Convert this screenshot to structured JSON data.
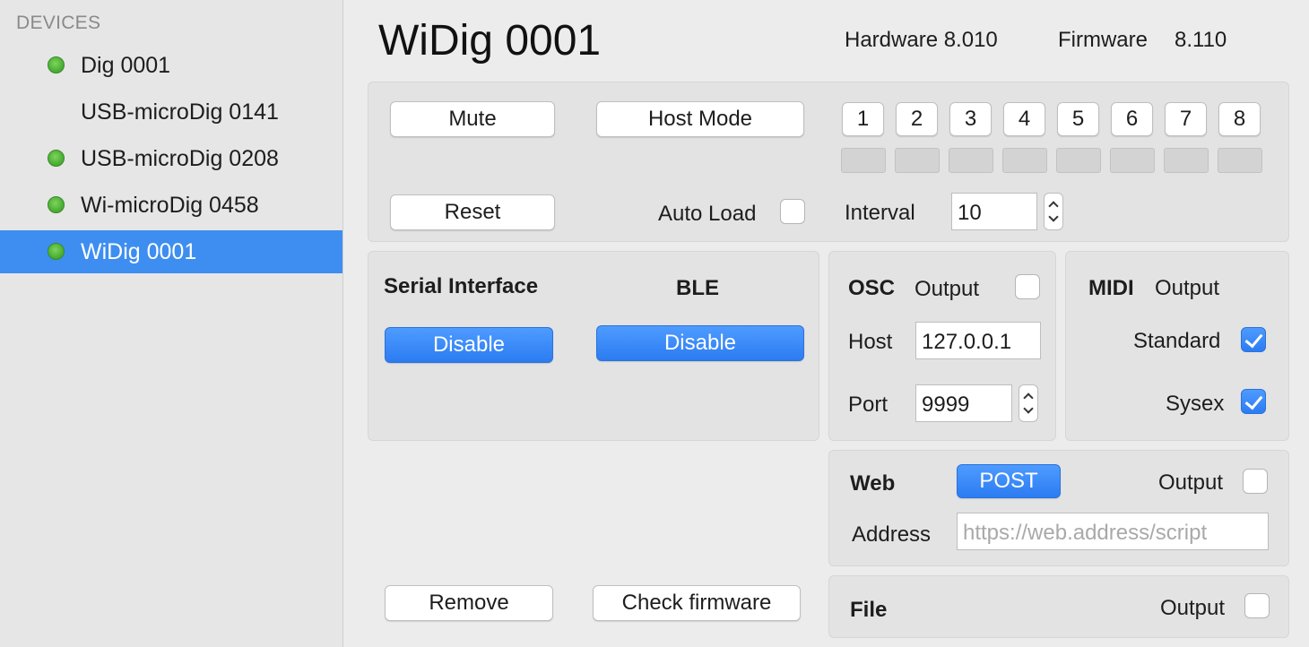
{
  "sidebar": {
    "header": "DEVICES",
    "items": [
      {
        "label": "Dig 0001",
        "status": "online"
      },
      {
        "label": "USB-microDig 0141",
        "status": "none"
      },
      {
        "label": "USB-microDig 0208",
        "status": "online"
      },
      {
        "label": "Wi-microDig 0458",
        "status": "online"
      },
      {
        "label": "WiDig 0001",
        "status": "online",
        "selected": true
      }
    ]
  },
  "header": {
    "title": "WiDig 0001",
    "hardware_label": "Hardware 8.010",
    "firmware_label": "Firmware",
    "firmware_value": "8.110"
  },
  "controls": {
    "mute": "Mute",
    "host_mode": "Host Mode",
    "reset": "Reset",
    "auto_load": "Auto Load",
    "auto_load_checked": false,
    "interval_label": "Interval",
    "interval_value": "10",
    "channels": [
      "1",
      "2",
      "3",
      "4",
      "5",
      "6",
      "7",
      "8"
    ]
  },
  "serial": {
    "title": "Serial Interface",
    "button": "Disable"
  },
  "ble": {
    "title": "BLE",
    "button": "Disable"
  },
  "osc": {
    "title": "OSC",
    "output_label": "Output",
    "output_checked": false,
    "host_label": "Host",
    "host_value": "127.0.0.1",
    "port_label": "Port",
    "port_value": "9999"
  },
  "midi": {
    "title": "MIDI",
    "output_label": "Output",
    "standard_label": "Standard",
    "standard_checked": true,
    "sysex_label": "Sysex",
    "sysex_checked": true
  },
  "web": {
    "title": "Web",
    "method_button": "POST",
    "output_label": "Output",
    "output_checked": false,
    "address_label": "Address",
    "address_placeholder": "https://web.address/script"
  },
  "file": {
    "title": "File",
    "output_label": "Output",
    "output_checked": false
  },
  "footer": {
    "remove": "Remove",
    "check_firmware": "Check firmware"
  },
  "colors": {
    "accent": "#3d8ef0",
    "status_online": "#4cb034"
  }
}
